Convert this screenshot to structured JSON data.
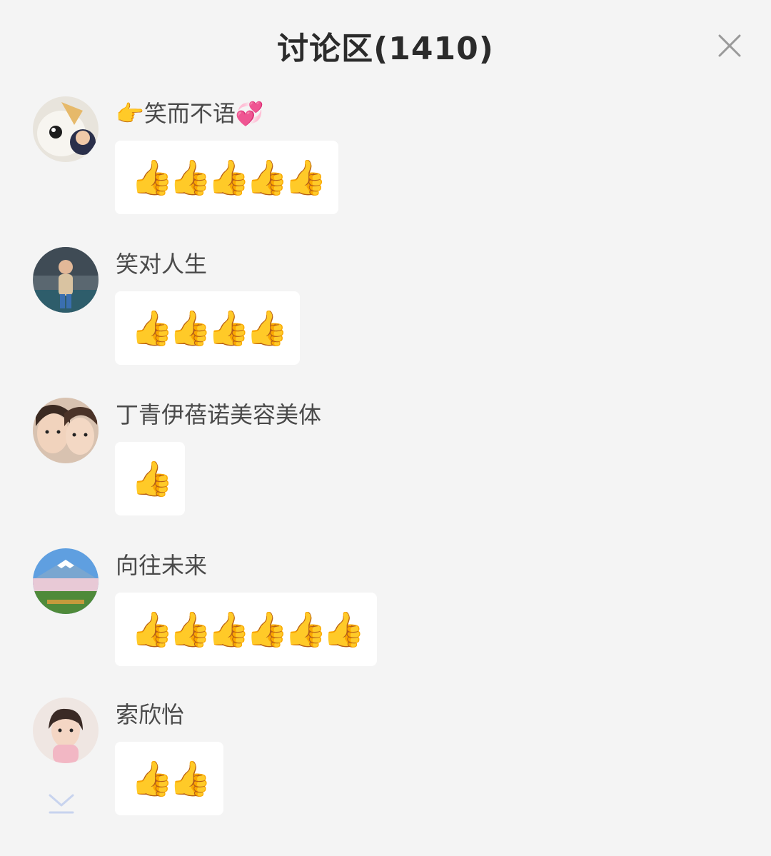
{
  "header": {
    "title": "讨论区(1410)",
    "close_icon": "close-icon"
  },
  "comments": [
    {
      "username": "👉笑而不语💞",
      "content": "👍👍👍👍👍",
      "avatar_icon": "cartoon-character-avatar"
    },
    {
      "username": "笑对人生",
      "content": "👍👍👍👍",
      "avatar_icon": "person-photo-avatar"
    },
    {
      "username": "丁青伊蓓诺美容美体",
      "content": "👍",
      "avatar_icon": "two-faces-photo-avatar"
    },
    {
      "username": "向往未来",
      "content": "👍👍👍👍👍👍",
      "avatar_icon": "landscape-mountain-avatar"
    },
    {
      "username": "索欣怡",
      "content": "👍👍",
      "avatar_icon": "girl-photo-avatar"
    }
  ],
  "scroll_down_icon": "scroll-to-bottom-icon",
  "colors": {
    "background": "#f4f4f4",
    "bubble": "#ffffff",
    "title": "#2b2b2b",
    "username": "#4a4a4a",
    "scroll_icon": "#c8d3ee"
  }
}
